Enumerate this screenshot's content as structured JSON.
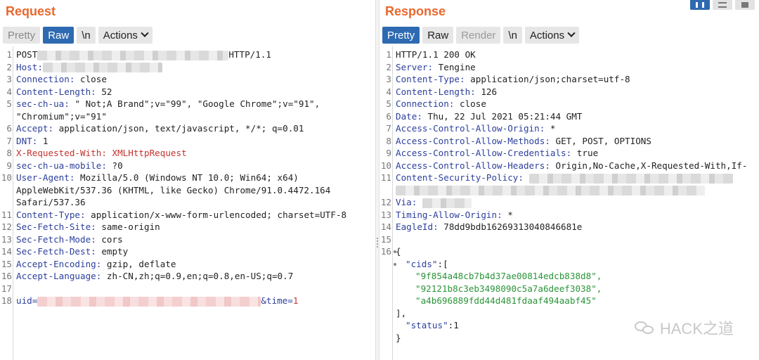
{
  "request": {
    "title": "Request",
    "tabs": {
      "pretty": "Pretty",
      "raw": "Raw",
      "newline": "\\n",
      "actions": "Actions"
    },
    "lines": [
      {
        "n": "1",
        "a": "POST",
        "b": "",
        "c": "HTTP/1.1"
      },
      {
        "n": "2",
        "k": "Host",
        "v": ""
      },
      {
        "n": "3",
        "k": "Connection",
        "v": " close"
      },
      {
        "n": "4",
        "k": "Content-Length",
        "v": " 52"
      },
      {
        "n": "5",
        "k": "sec-ch-ua",
        "v": " \" Not;A Brand\";v=\"99\", \"Google Chrome\";v=\"91\","
      },
      {
        "n": "",
        "v": "\"Chromium\";v=\"91\""
      },
      {
        "n": "6",
        "k": "Accept",
        "v": " application/json, text/javascript, */*; q=0.01"
      },
      {
        "n": "7",
        "k": "DNT",
        "v": " 1"
      },
      {
        "n": "8",
        "k": "X-Requested-With",
        "v": " XMLHttpRequest",
        "hl": true
      },
      {
        "n": "9",
        "k": "sec-ch-ua-mobile",
        "v": " ?0"
      },
      {
        "n": "10",
        "k": "User-Agent",
        "v": " Mozilla/5.0 (Windows NT 10.0; Win64; x64)"
      },
      {
        "n": "",
        "v": "AppleWebKit/537.36 (KHTML, like Gecko) Chrome/91.0.4472.164"
      },
      {
        "n": "",
        "v": "Safari/537.36"
      },
      {
        "n": "11",
        "k": "Content-Type",
        "v": " application/x-www-form-urlencoded; charset=UTF-8"
      },
      {
        "n": "12",
        "k": "Sec-Fetch-Site",
        "v": " same-origin"
      },
      {
        "n": "13",
        "k": "Sec-Fetch-Mode",
        "v": " cors"
      },
      {
        "n": "14",
        "k": "Sec-Fetch-Dest",
        "v": " empty"
      },
      {
        "n": "15",
        "k": "Accept-Encoding",
        "v": " gzip, deflate"
      },
      {
        "n": "16",
        "k": "Accept-Language",
        "v": " zh-CN,zh;q=0.9,en;q=0.8,en-US;q=0.7"
      },
      {
        "n": "17",
        "v": ""
      },
      {
        "n": "18",
        "body": true,
        "p1": "uid=",
        "p2": "&time=",
        "p3": "1"
      }
    ]
  },
  "response": {
    "title": "Response",
    "tabs": {
      "pretty": "Pretty",
      "raw": "Raw",
      "render": "Render",
      "newline": "\\n",
      "actions": "Actions"
    },
    "lines": [
      {
        "n": "1",
        "v": "HTTP/1.1 200 OK"
      },
      {
        "n": "2",
        "k": "Server",
        "v": " Tengine"
      },
      {
        "n": "3",
        "k": "Content-Type",
        "v": " application/json;charset=utf-8"
      },
      {
        "n": "4",
        "k": "Content-Length",
        "v": " 126"
      },
      {
        "n": "5",
        "k": "Connection",
        "v": " close"
      },
      {
        "n": "6",
        "k": "Date",
        "v": " Thu, 22 Jul 2021 05:21:44 GMT"
      },
      {
        "n": "7",
        "k": "Access-Control-Allow-Origin",
        "v": " *"
      },
      {
        "n": "8",
        "k": "Access-Control-Allow-Methods",
        "v": " GET, POST, OPTIONS"
      },
      {
        "n": "9",
        "k": "Access-Control-Allow-Credentials",
        "v": " true"
      },
      {
        "n": "10",
        "k": "Access-Control-Allow-Headers",
        "v": " Origin,No-Cache,X-Requested-With,If-"
      },
      {
        "n": "11",
        "k": "Content-Security-Policy",
        "v": " ",
        "redact": true
      },
      {
        "n": "",
        "v": "",
        "redactOnly": true
      },
      {
        "n": "12",
        "k": "Via",
        "v": " ",
        "redact": true
      },
      {
        "n": "13",
        "k": "Timing-Allow-Origin",
        "v": " *"
      },
      {
        "n": "14",
        "k": "EagleId",
        "v": " 78dd9bdb16269313040846681e"
      },
      {
        "n": "15",
        "v": ""
      },
      {
        "n": "16",
        "v": "{"
      },
      {
        "n": "",
        "jk": "\"cids\"",
        "v": ":["
      },
      {
        "n": "",
        "s": "\"9f854a48cb7b4d37ae00814edcb838d8\","
      },
      {
        "n": "",
        "s": "\"92121b8c3eb3498090c5a7a6deef3038\","
      },
      {
        "n": "",
        "s": "\"a4b696889fdd44d481fdaaf494aabf45\""
      },
      {
        "n": "",
        "v": "],"
      },
      {
        "n": "",
        "jk": "\"status\"",
        "v": ":1"
      },
      {
        "n": "",
        "v": "}"
      }
    ]
  },
  "watermark": "HACK之道"
}
